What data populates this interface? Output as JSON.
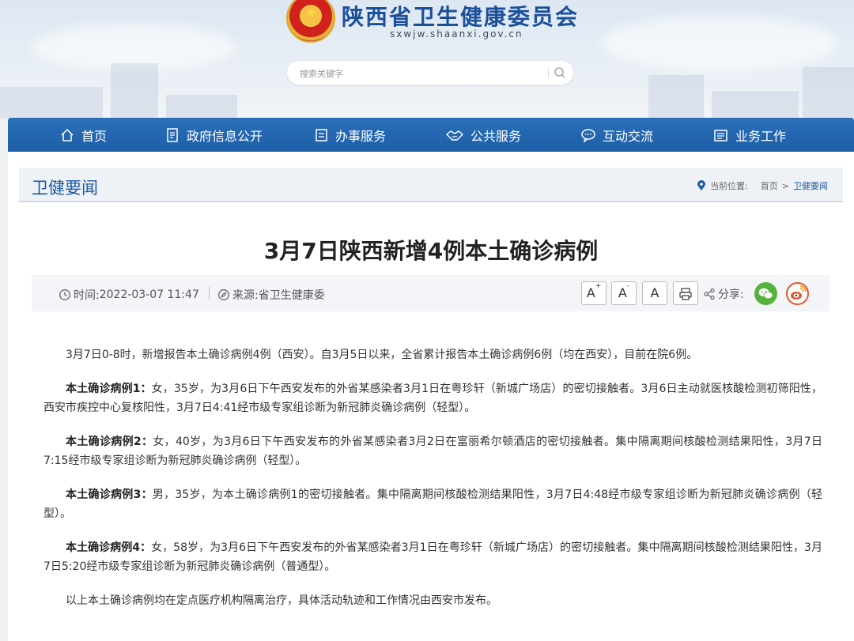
{
  "header": {
    "site_title": "陕西省卫生健康委员会",
    "site_domain": "sxwjw.shaanxi.gov.cn",
    "search_placeholder": "搜索关键字",
    "search_icon": "search-icon",
    "emblem_icon": "national-emblem-icon"
  },
  "nav": {
    "items": [
      {
        "label": "首页",
        "icon": "home-icon"
      },
      {
        "label": "政府信息公开",
        "icon": "document-list-icon"
      },
      {
        "label": "办事服务",
        "icon": "form-icon"
      },
      {
        "label": "公共服务",
        "icon": "handshake-icon"
      },
      {
        "label": "互动交流",
        "icon": "chat-icon"
      },
      {
        "label": "业务工作",
        "icon": "briefcase-icon"
      }
    ]
  },
  "section": {
    "title": "卫健要闻",
    "breadcrumb_label": "当前位置:",
    "breadcrumb_home": "首页",
    "breadcrumb_sep": ">",
    "breadcrumb_current": "卫健要闻"
  },
  "article": {
    "title": "3月7日陕西新增4例本土确诊病例",
    "time_label": "时间:",
    "time_value": "2022-03-07 11:47",
    "source_label": "来源:",
    "source_value": "省卫生健康委",
    "font_buttons": {
      "increase": "A",
      "increase_sup": "+",
      "decrease": "A",
      "decrease_sup": "-",
      "reset": "A"
    },
    "share_label": "分享:",
    "share_colors": {
      "wechat": "#56b13f",
      "weibo": "#e8552a"
    },
    "paragraphs": [
      {
        "lead": "",
        "text": "3月7日0-8时，新增报告本土确诊病例4例（西安）。自3月5日以来，全省累计报告本土确诊病例6例（均在西安），目前在院6例。"
      },
      {
        "lead": "本土确诊病例1：",
        "text": "女，35岁，为3月6日下午西安发布的外省某感染者3月1日在粤珍轩（新城广场店）的密切接触者。3月6日主动就医核酸检测初筛阳性，西安市疾控中心复核阳性，3月7日4:41经市级专家组诊断为新冠肺炎确诊病例（轻型）。"
      },
      {
        "lead": "本土确诊病例2：",
        "text": "女，40岁，为3月6日下午西安发布的外省某感染者3月2日在富丽希尔顿酒店的密切接触者。集中隔离期间核酸检测结果阳性，3月7日7:15经市级专家组诊断为新冠肺炎确诊病例（轻型）。"
      },
      {
        "lead": "本土确诊病例3：",
        "text": "男，35岁，为本土确诊病例1的密切接触者。集中隔离期间核酸检测结果阳性，3月7日4:48经市级专家组诊断为新冠肺炎确诊病例（轻型）。"
      },
      {
        "lead": "本土确诊病例4：",
        "text": "女，58岁，为3月6日下午西安发布的外省某感染者3月1日在粤珍轩（新城广场店）的密切接触者。集中隔离期间核酸检测结果阳性，3月7日5:20经市级专家组诊断为新冠肺炎确诊病例（普通型）。"
      },
      {
        "lead": "",
        "text": "以上本土确诊病例均在定点医疗机构隔离治疗，具体活动轨迹和工作情况由西安市发布。"
      }
    ]
  }
}
